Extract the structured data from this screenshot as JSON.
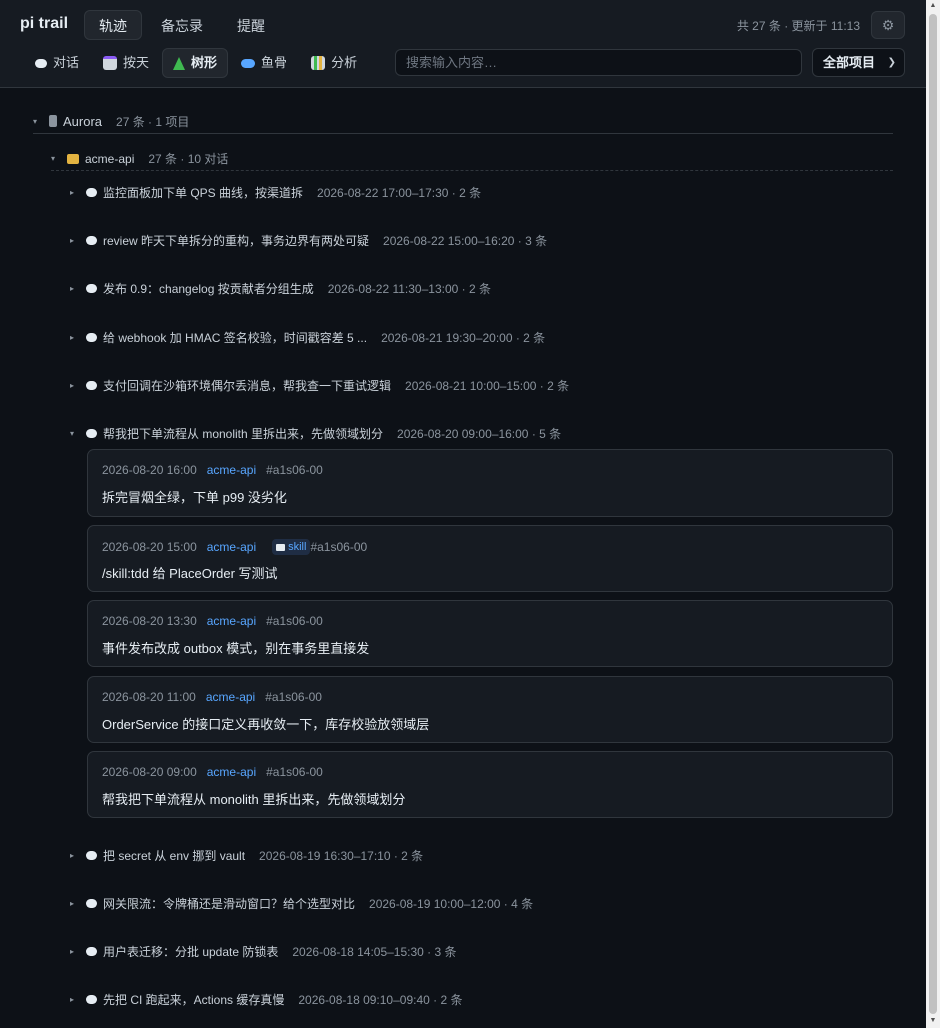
{
  "app": {
    "title": "pi trail"
  },
  "header": {
    "tabs": [
      {
        "label": "轨迹"
      },
      {
        "label": "备忘录"
      },
      {
        "label": "提醒"
      }
    ],
    "meta": "共 27 条 · 更新于 11:13",
    "settings_icon": "⚙"
  },
  "views": [
    {
      "label": "对话",
      "icon": "speech-bubble-icon"
    },
    {
      "label": "按天",
      "icon": "calendar-icon"
    },
    {
      "label": "树形",
      "icon": "tree-icon"
    },
    {
      "label": "鱼骨",
      "icon": "fish-icon"
    },
    {
      "label": "分析",
      "icon": "bar-chart-icon"
    }
  ],
  "search": {
    "placeholder": "搜索输入内容…",
    "value": ""
  },
  "filter": {
    "selected": "全部项目"
  },
  "tree": {
    "project": {
      "name": "Aurora",
      "count": "27 条 · 1 项目"
    },
    "folder": {
      "name": "acme-api",
      "count": "27 条 · 10 对话"
    },
    "conversations": [
      {
        "title": "监控面板加下单 QPS 曲线，按渠道拆",
        "meta": "2026-08-22 17:00–17:30 · 2 条"
      },
      {
        "title": "review 昨天下单拆分的重构，事务边界有两处可疑",
        "meta": "2026-08-22 15:00–16:20 · 3 条"
      },
      {
        "title": "发布 0.9：changelog 按贡献者分组生成",
        "meta": "2026-08-22 11:30–13:00 · 2 条"
      },
      {
        "title": "给 webhook 加 HMAC 签名校验，时间戳容差 5 ...",
        "meta": "2026-08-21 19:30–20:00 · 2 条"
      },
      {
        "title": "支付回调在沙箱环境偶尔丢消息，帮我查一下重试逻辑",
        "meta": "2026-08-21 10:00–15:00 · 2 条"
      },
      {
        "title": "帮我把下单流程从 monolith 里拆出来，先做领域划分",
        "meta": "2026-08-20 09:00–16:00 · 5 条"
      },
      {
        "title": "把 secret 从 env 挪到 vault",
        "meta": "2026-08-19 16:30–17:10 · 2 条"
      },
      {
        "title": "网关限流：令牌桶还是滑动窗口？给个选型对比",
        "meta": "2026-08-19 10:00–12:00 · 4 条"
      },
      {
        "title": "用户表迁移：分批 update 防锁表",
        "meta": "2026-08-18 14:05–15:30 · 3 条"
      },
      {
        "title": "先把 CI 跑起来，Actions 缓存真慢",
        "meta": "2026-08-18 09:10–09:40 · 2 条"
      }
    ],
    "entries": [
      {
        "time": "2026-08-20 16:00",
        "project": "acme-api",
        "badge": "",
        "id": "#a1s06-00",
        "text": "拆完冒烟全绿，下单 p99 没劣化"
      },
      {
        "time": "2026-08-20 15:00",
        "project": "acme-api",
        "badge": "skill",
        "id": "#a1s06-00",
        "text": "/skill:tdd 给 PlaceOrder 写测试"
      },
      {
        "time": "2026-08-20 13:30",
        "project": "acme-api",
        "badge": "",
        "id": "#a1s06-00",
        "text": "事件发布改成 outbox 模式，别在事务里直接发"
      },
      {
        "time": "2026-08-20 11:00",
        "project": "acme-api",
        "badge": "",
        "id": "#a1s06-00",
        "text": "OrderService 的接口定义再收敛一下，库存校验放领域层"
      },
      {
        "time": "2026-08-20 09:00",
        "project": "acme-api",
        "badge": "",
        "id": "#a1s06-00",
        "text": "帮我把下单流程从 monolith 里拆出来，先做领域划分"
      }
    ]
  }
}
